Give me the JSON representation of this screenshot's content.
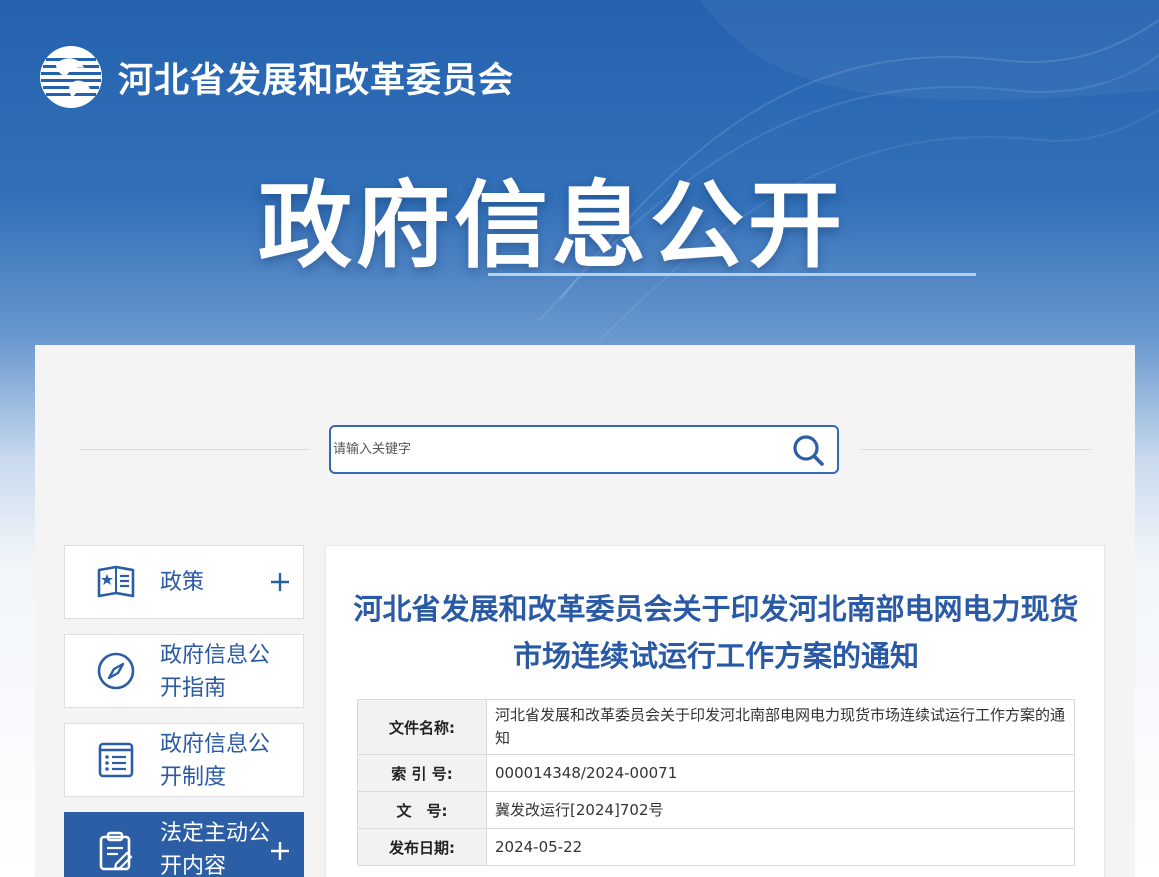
{
  "site": {
    "name": "河北省发展和改革委员会",
    "banner_title": "政府信息公开"
  },
  "search": {
    "placeholder": "请输入关键字"
  },
  "nav": [
    {
      "label": "政策",
      "icon": "book-star-icon",
      "expandable": true
    },
    {
      "label": "政府信息公开指南",
      "icon": "compass-icon",
      "expandable": false
    },
    {
      "label": "政府信息公开制度",
      "icon": "list-document-icon",
      "expandable": false
    },
    {
      "label": "法定主动公开内容",
      "icon": "clipboard-edit-icon",
      "expandable": true,
      "active": true
    }
  ],
  "article": {
    "title": "河北省发展和改革委员会关于印发河北南部电网电力现货市场连续试运行工作方案的通知",
    "meta": {
      "file_name_label": "文件名称:",
      "file_name": "河北省发展和改革委员会关于印发河北南部电网电力现货市场连续试运行工作方案的通知",
      "index_label": "索 引 号:",
      "index": "000014348/2024-00071",
      "doc_no_label": "文　号:",
      "doc_no": "冀发改运行[2024]702号",
      "date_label": "发布日期:",
      "date": "2024-05-22"
    }
  },
  "colors": {
    "brand_blue": "#2a5aa5",
    "banner_blue": "#2462b0",
    "active_nav": "#2c5ea6"
  }
}
